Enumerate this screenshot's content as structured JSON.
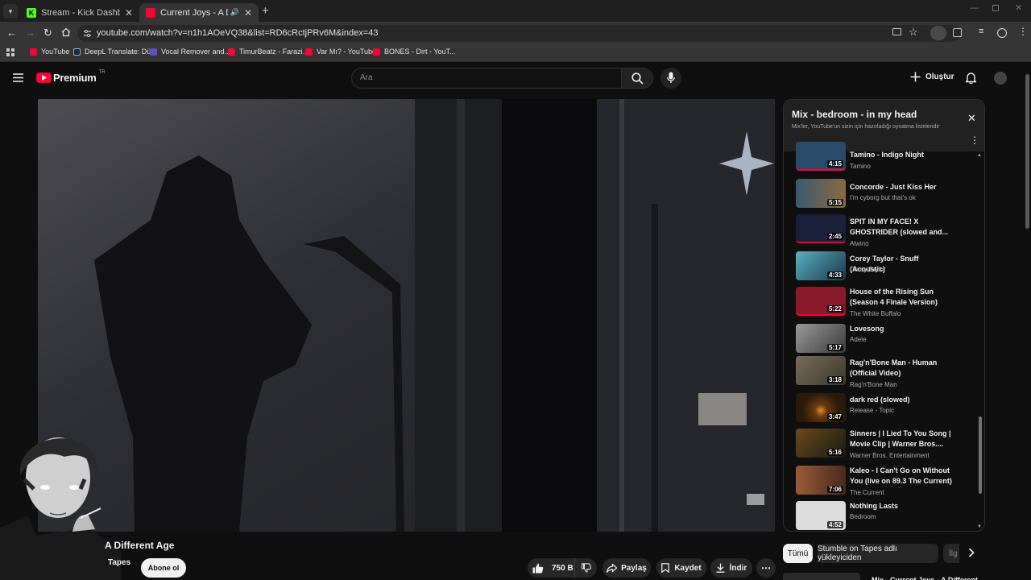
{
  "browser": {
    "tabs": [
      {
        "title": "Stream - Kick Dashboard",
        "favicon_color": "#53fc18"
      },
      {
        "title": "Current Joys - A Different A",
        "favicon_color": "#ff0033"
      }
    ],
    "url": "youtube.com/watch?v=n1h1AOeVQ38&list=RD6cRctjPRv6M&index=43",
    "bookmarks": [
      {
        "label": "YouTube",
        "color": "#ff0033"
      },
      {
        "label": "DeepL Translate: Dü...",
        "color": "#0f2b46"
      },
      {
        "label": "Vocal Remover and...",
        "color": "#5a4fcf"
      },
      {
        "label": "TimurBeatz - Farazi...",
        "color": "#ff0033"
      },
      {
        "label": "Var Mı? - YouTube",
        "color": "#ff0033"
      },
      {
        "label": "BONES - Dirt - YouT...",
        "color": "#ff0033"
      }
    ]
  },
  "header": {
    "logo_text": "Premium",
    "logo_sup": "TR",
    "search_placeholder": "Ara",
    "create_label": "Oluştur"
  },
  "playlist": {
    "title": "Mix - bedroom - in my head",
    "subtitle": "Mix'ler, YouTube'un sizin için hazırladığı oynatma listeleridir",
    "items": [
      {
        "title": "Tamino - Indigo Night",
        "channel": "Tamino",
        "duration": "4:15",
        "color": "#2a4a6a"
      },
      {
        "title": "Concorde - Just Kiss Her",
        "channel": "I'm cyborg but that's ok",
        "duration": "5:15",
        "color": "#3a5a70"
      },
      {
        "title": "SPIT IN MY FACE! X GHOSTRIDER (slowed and...",
        "channel": "Alwino",
        "duration": "2:45",
        "color": "#1a1f3a"
      },
      {
        "title": "Corey Taylor - Snuff (Acoustic)",
        "channel": "Corey Taylor",
        "duration": "4:33",
        "color": "#2a5a6a"
      },
      {
        "title": "House of the Rising Sun (Season 4 Finale Version)",
        "channel": "The White Buffalo",
        "duration": "5:22",
        "color": "#8a1a2a"
      },
      {
        "title": "Lovesong",
        "channel": "Adele",
        "duration": "5:17",
        "color": "#6a6a6a"
      },
      {
        "title": "Rag'n'Bone Man - Human (Official Video)",
        "channel": "Rag'n'Bone Man",
        "duration": "3:18",
        "color": "#5a4a3a"
      },
      {
        "title": "dark red (slowed)",
        "channel": "Release - Topic",
        "duration": "3:47",
        "color": "#3a2a1a"
      },
      {
        "title": "Sinners | I Lied To You Song | Movie Clip | Warner Bros....",
        "channel": "Warner Bros. Entertainment",
        "duration": "5:16",
        "color": "#3a2a10"
      },
      {
        "title": "Kaleo - I Can't Go on Without You (live on 89.3 The Current)",
        "channel": "The Current",
        "duration": "7:06",
        "color": "#6a3a2a"
      },
      {
        "title": "Nothing Lasts",
        "channel": "Bedroom",
        "duration": "4:52",
        "color": "#dcdcdc"
      }
    ]
  },
  "video": {
    "title": "A Different Age",
    "channel": "Tapes",
    "subscribe_label": "Abone ol",
    "like_count": "750 B",
    "share_label": "Paylaş",
    "save_label": "Kaydet",
    "download_label": "İndir"
  },
  "chips": [
    "Tümü",
    "Stumble on Tapes adlı yükleyiciden",
    "İlg"
  ],
  "next_up_partial": "Mix - Current Joys - A Different..."
}
